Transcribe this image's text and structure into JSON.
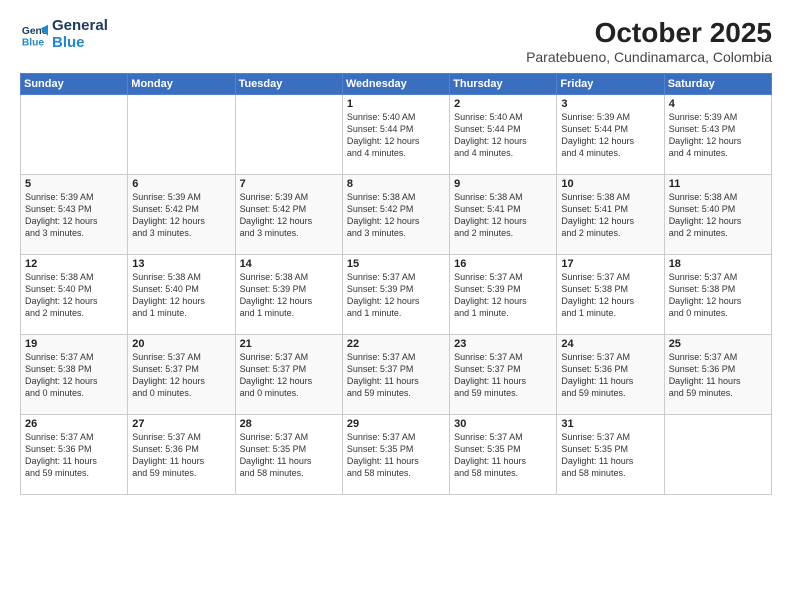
{
  "logo": {
    "line1": "General",
    "line2": "Blue"
  },
  "title": "October 2025",
  "subtitle": "Paratebueno, Cundinamarca, Colombia",
  "weekdays": [
    "Sunday",
    "Monday",
    "Tuesday",
    "Wednesday",
    "Thursday",
    "Friday",
    "Saturday"
  ],
  "weeks": [
    [
      {
        "day": "",
        "info": ""
      },
      {
        "day": "",
        "info": ""
      },
      {
        "day": "",
        "info": ""
      },
      {
        "day": "1",
        "info": "Sunrise: 5:40 AM\nSunset: 5:44 PM\nDaylight: 12 hours\nand 4 minutes."
      },
      {
        "day": "2",
        "info": "Sunrise: 5:40 AM\nSunset: 5:44 PM\nDaylight: 12 hours\nand 4 minutes."
      },
      {
        "day": "3",
        "info": "Sunrise: 5:39 AM\nSunset: 5:44 PM\nDaylight: 12 hours\nand 4 minutes."
      },
      {
        "day": "4",
        "info": "Sunrise: 5:39 AM\nSunset: 5:43 PM\nDaylight: 12 hours\nand 4 minutes."
      }
    ],
    [
      {
        "day": "5",
        "info": "Sunrise: 5:39 AM\nSunset: 5:43 PM\nDaylight: 12 hours\nand 3 minutes."
      },
      {
        "day": "6",
        "info": "Sunrise: 5:39 AM\nSunset: 5:42 PM\nDaylight: 12 hours\nand 3 minutes."
      },
      {
        "day": "7",
        "info": "Sunrise: 5:39 AM\nSunset: 5:42 PM\nDaylight: 12 hours\nand 3 minutes."
      },
      {
        "day": "8",
        "info": "Sunrise: 5:38 AM\nSunset: 5:42 PM\nDaylight: 12 hours\nand 3 minutes."
      },
      {
        "day": "9",
        "info": "Sunrise: 5:38 AM\nSunset: 5:41 PM\nDaylight: 12 hours\nand 2 minutes."
      },
      {
        "day": "10",
        "info": "Sunrise: 5:38 AM\nSunset: 5:41 PM\nDaylight: 12 hours\nand 2 minutes."
      },
      {
        "day": "11",
        "info": "Sunrise: 5:38 AM\nSunset: 5:40 PM\nDaylight: 12 hours\nand 2 minutes."
      }
    ],
    [
      {
        "day": "12",
        "info": "Sunrise: 5:38 AM\nSunset: 5:40 PM\nDaylight: 12 hours\nand 2 minutes."
      },
      {
        "day": "13",
        "info": "Sunrise: 5:38 AM\nSunset: 5:40 PM\nDaylight: 12 hours\nand 1 minute."
      },
      {
        "day": "14",
        "info": "Sunrise: 5:38 AM\nSunset: 5:39 PM\nDaylight: 12 hours\nand 1 minute."
      },
      {
        "day": "15",
        "info": "Sunrise: 5:37 AM\nSunset: 5:39 PM\nDaylight: 12 hours\nand 1 minute."
      },
      {
        "day": "16",
        "info": "Sunrise: 5:37 AM\nSunset: 5:39 PM\nDaylight: 12 hours\nand 1 minute."
      },
      {
        "day": "17",
        "info": "Sunrise: 5:37 AM\nSunset: 5:38 PM\nDaylight: 12 hours\nand 1 minute."
      },
      {
        "day": "18",
        "info": "Sunrise: 5:37 AM\nSunset: 5:38 PM\nDaylight: 12 hours\nand 0 minutes."
      }
    ],
    [
      {
        "day": "19",
        "info": "Sunrise: 5:37 AM\nSunset: 5:38 PM\nDaylight: 12 hours\nand 0 minutes."
      },
      {
        "day": "20",
        "info": "Sunrise: 5:37 AM\nSunset: 5:37 PM\nDaylight: 12 hours\nand 0 minutes."
      },
      {
        "day": "21",
        "info": "Sunrise: 5:37 AM\nSunset: 5:37 PM\nDaylight: 12 hours\nand 0 minutes."
      },
      {
        "day": "22",
        "info": "Sunrise: 5:37 AM\nSunset: 5:37 PM\nDaylight: 11 hours\nand 59 minutes."
      },
      {
        "day": "23",
        "info": "Sunrise: 5:37 AM\nSunset: 5:37 PM\nDaylight: 11 hours\nand 59 minutes."
      },
      {
        "day": "24",
        "info": "Sunrise: 5:37 AM\nSunset: 5:36 PM\nDaylight: 11 hours\nand 59 minutes."
      },
      {
        "day": "25",
        "info": "Sunrise: 5:37 AM\nSunset: 5:36 PM\nDaylight: 11 hours\nand 59 minutes."
      }
    ],
    [
      {
        "day": "26",
        "info": "Sunrise: 5:37 AM\nSunset: 5:36 PM\nDaylight: 11 hours\nand 59 minutes."
      },
      {
        "day": "27",
        "info": "Sunrise: 5:37 AM\nSunset: 5:36 PM\nDaylight: 11 hours\nand 59 minutes."
      },
      {
        "day": "28",
        "info": "Sunrise: 5:37 AM\nSunset: 5:35 PM\nDaylight: 11 hours\nand 58 minutes."
      },
      {
        "day": "29",
        "info": "Sunrise: 5:37 AM\nSunset: 5:35 PM\nDaylight: 11 hours\nand 58 minutes."
      },
      {
        "day": "30",
        "info": "Sunrise: 5:37 AM\nSunset: 5:35 PM\nDaylight: 11 hours\nand 58 minutes."
      },
      {
        "day": "31",
        "info": "Sunrise: 5:37 AM\nSunset: 5:35 PM\nDaylight: 11 hours\nand 58 minutes."
      },
      {
        "day": "",
        "info": ""
      }
    ]
  ]
}
